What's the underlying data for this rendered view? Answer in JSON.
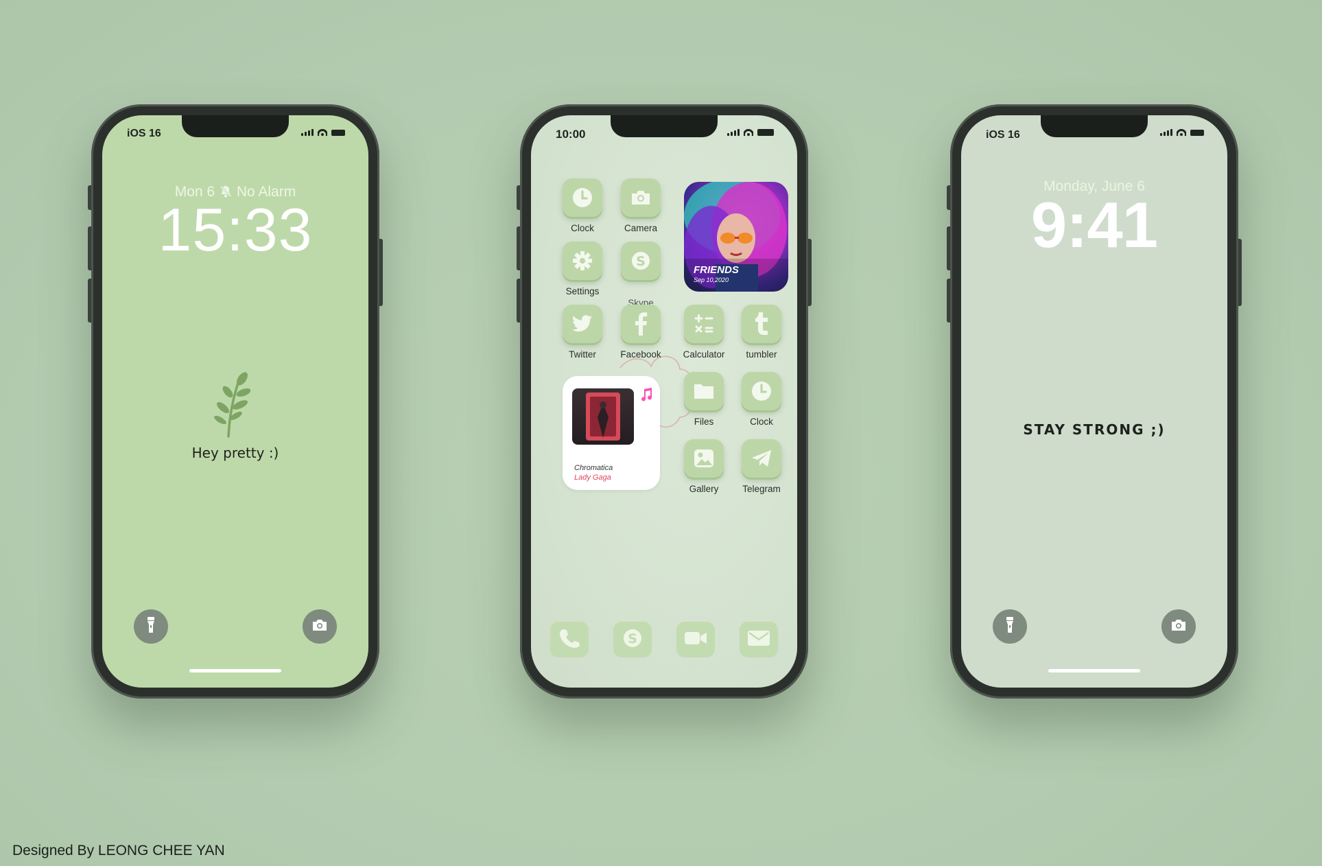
{
  "phone1": {
    "status": "iOS 16",
    "date_line": "Mon 6",
    "alarm_text": "No Alarm",
    "time": "15:33",
    "message": "Hey pretty :)"
  },
  "phone2": {
    "status_time": "10:00",
    "apps": {
      "clock": "Clock",
      "camera": "Camera",
      "settings": "Settings",
      "skype": "Skype",
      "twitter": "Twitter",
      "facebook": "Facebook",
      "calculator": "Calculator",
      "tumbler": "tumbler",
      "files": "Files",
      "clock2": "Clock",
      "gallery": "Gallery",
      "telegram": "Telegram"
    },
    "photo_widget": {
      "title": "FRIENDS",
      "date": "Sep 10,2020"
    },
    "music_widget": {
      "album": "Chromatica",
      "artist": "Lady Gaga",
      "accent": "#ff4fb8"
    },
    "dock": [
      "phone-icon",
      "skype-icon",
      "video-icon",
      "mail-icon"
    ]
  },
  "phone3": {
    "status": "iOS 16",
    "date_line": "Monday, June 6",
    "time": "9:41",
    "message": "STAY STRONG ;)"
  },
  "credit": "Designed By LEONG CHEE YAN",
  "colors": {
    "background": "#b3cbb0",
    "lock1_bg": "#bed9a9",
    "home_bg": "#d3e1cf",
    "lock3_bg": "#cfdccc",
    "app_icon": "#bdd6a8"
  }
}
